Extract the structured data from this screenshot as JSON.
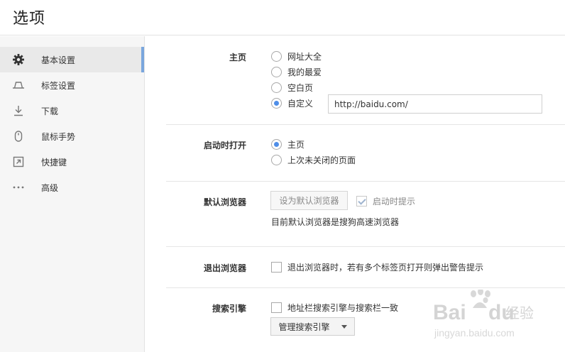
{
  "header": {
    "title": "选项"
  },
  "sidebar": {
    "items": [
      {
        "label": "基本设置",
        "icon": "gear-icon",
        "active": true
      },
      {
        "label": "标签设置",
        "icon": "tab-icon",
        "active": false
      },
      {
        "label": "下载",
        "icon": "download-icon",
        "active": false
      },
      {
        "label": "鼠标手势",
        "icon": "mouse-icon",
        "active": false
      },
      {
        "label": "快捷键",
        "icon": "shortcut-icon",
        "active": false
      },
      {
        "label": "高级",
        "icon": "more-icon",
        "active": false
      }
    ]
  },
  "homepage": {
    "label": "主页",
    "options": [
      "网址大全",
      "我的最爱",
      "空白页",
      "自定义"
    ],
    "selected": "自定义",
    "custom_url": "http://baidu.com/"
  },
  "startup": {
    "label": "启动时打开",
    "options": [
      "主页",
      "上次未关闭的页面"
    ],
    "selected": "主页"
  },
  "default_browser": {
    "label": "默认浏览器",
    "set_default_button": "设为默认浏览器",
    "startup_prompt_label": "启动时提示",
    "startup_prompt_checked": true,
    "status_text": "目前默认浏览器是搜狗高速浏览器"
  },
  "exit_browser": {
    "label": "退出浏览器",
    "warn_label": "退出浏览器时，若有多个标签页打开则弹出警告提示",
    "warn_checked": false
  },
  "search_engine": {
    "label": "搜索引擎",
    "sync_label": "地址栏搜索引擎与搜索栏一致",
    "sync_checked": false,
    "manage_button": "管理搜索引擎"
  },
  "watermark": {
    "text1": "Bai",
    "text2": "du",
    "text3": "经验",
    "url": "jingyan.baidu.com"
  },
  "colors": {
    "accent": "#4f8ee8",
    "active_bar": "#7aa6dd",
    "sidebar_bg": "#f6f6f6"
  }
}
